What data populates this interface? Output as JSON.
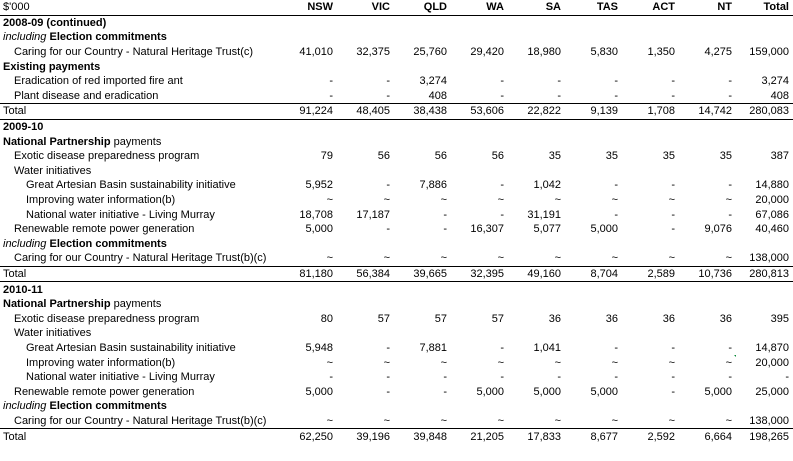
{
  "headers": [
    "$'000",
    "NSW",
    "VIC",
    "QLD",
    "WA",
    "SA",
    "TAS",
    "ACT",
    "NT",
    "Total"
  ],
  "rows": [
    {
      "kind": "year",
      "label": "2008-09 (continued)"
    },
    {
      "kind": "section",
      "prefix": "including",
      "label": "Election commitments"
    },
    {
      "kind": "data",
      "indent": 1,
      "label": "Caring for our Country - Natural Heritage Trust(c)",
      "values": [
        "41,010",
        "32,375",
        "25,760",
        "29,420",
        "18,980",
        "5,830",
        "1,350",
        "4,275",
        "159,000"
      ]
    },
    {
      "kind": "section",
      "prefix": "",
      "label": "Existing payments"
    },
    {
      "kind": "data",
      "indent": 1,
      "label": "Eradication of red imported fire ant",
      "values": [
        "-",
        "-",
        "3,274",
        "-",
        "-",
        "-",
        "-",
        "-",
        "3,274"
      ]
    },
    {
      "kind": "data",
      "indent": 1,
      "label": "Plant disease and eradication",
      "values": [
        "-",
        "-",
        "408",
        "-",
        "-",
        "-",
        "-",
        "-",
        "408"
      ]
    },
    {
      "kind": "total",
      "label": "Total",
      "values": [
        "91,224",
        "48,405",
        "38,438",
        "53,606",
        "22,822",
        "9,139",
        "1,708",
        "14,742",
        "280,083"
      ]
    },
    {
      "kind": "year",
      "label": "2009-10"
    },
    {
      "kind": "section",
      "prefix": "",
      "label": "National Partnership",
      "suffix": " payments"
    },
    {
      "kind": "data",
      "indent": 1,
      "label": "Exotic disease preparedness program",
      "values": [
        "79",
        "56",
        "56",
        "56",
        "35",
        "35",
        "35",
        "35",
        "387"
      ]
    },
    {
      "kind": "data",
      "indent": 1,
      "label": "Water initiatives",
      "values": [
        "",
        "",
        "",
        "",
        "",
        "",
        "",
        "",
        ""
      ]
    },
    {
      "kind": "data",
      "indent": 2,
      "label": "Great Artesian Basin sustainability initiative",
      "values": [
        "5,952",
        "-",
        "7,886",
        "-",
        "1,042",
        "-",
        "-",
        "-",
        "14,880"
      ]
    },
    {
      "kind": "data",
      "indent": 2,
      "label": "Improving water information(b)",
      "values": [
        "~",
        "~",
        "~",
        "~",
        "~",
        "~",
        "~",
        "~",
        "20,000"
      ]
    },
    {
      "kind": "data",
      "indent": 2,
      "label": "National water initiative - Living Murray",
      "values": [
        "18,708",
        "17,187",
        "-",
        "-",
        "31,191",
        "-",
        "-",
        "-",
        "67,086"
      ]
    },
    {
      "kind": "data",
      "indent": 1,
      "label": "Renewable remote power generation",
      "values": [
        "5,000",
        "-",
        "-",
        "16,307",
        "5,077",
        "5,000",
        "-",
        "9,076",
        "40,460"
      ]
    },
    {
      "kind": "section",
      "prefix": "including",
      "label": "Election commitments"
    },
    {
      "kind": "data",
      "indent": 1,
      "label": "Caring for our Country - Natural Heritage Trust(b)(c)",
      "values": [
        "~",
        "~",
        "~",
        "~",
        "~",
        "~",
        "~",
        "~",
        "138,000"
      ]
    },
    {
      "kind": "total",
      "label": "Total",
      "values": [
        "81,180",
        "56,384",
        "39,665",
        "32,395",
        "49,160",
        "8,704",
        "2,589",
        "10,736",
        "280,813"
      ]
    },
    {
      "kind": "year",
      "label": "2010-11"
    },
    {
      "kind": "section",
      "prefix": "",
      "label": "National Partnership",
      "suffix": " payments"
    },
    {
      "kind": "data",
      "indent": 1,
      "label": "Exotic disease preparedness program",
      "values": [
        "80",
        "57",
        "57",
        "57",
        "36",
        "36",
        "36",
        "36",
        "395"
      ]
    },
    {
      "kind": "data",
      "indent": 1,
      "label": "Water initiatives",
      "values": [
        "",
        "",
        "",
        "",
        "",
        "",
        "",
        "",
        ""
      ]
    },
    {
      "kind": "data",
      "indent": 2,
      "label": "Great Artesian Basin sustainability initiative",
      "values": [
        "5,948",
        "-",
        "7,881",
        "-",
        "1,041",
        "-",
        "-",
        "-",
        "14,870"
      ]
    },
    {
      "kind": "data",
      "indent": 2,
      "label": "Improving water information(b)",
      "values": [
        "~",
        "~",
        "~",
        "~",
        "~",
        "~",
        "~",
        "~",
        "20,000"
      ],
      "marker_col": 7
    },
    {
      "kind": "data",
      "indent": 2,
      "label": "National water initiative - Living Murray",
      "values": [
        "-",
        "-",
        "-",
        "-",
        "-",
        "-",
        "-",
        "-",
        "-"
      ]
    },
    {
      "kind": "data",
      "indent": 1,
      "label": "Renewable remote power generation",
      "values": [
        "5,000",
        "-",
        "-",
        "5,000",
        "5,000",
        "5,000",
        "-",
        "5,000",
        "25,000"
      ]
    },
    {
      "kind": "section",
      "prefix": "including",
      "label": "Election commitments"
    },
    {
      "kind": "data",
      "indent": 1,
      "label": "Caring for our Country - Natural Heritage Trust(b)(c)",
      "values": [
        "~",
        "~",
        "~",
        "~",
        "~",
        "~",
        "~",
        "~",
        "138,000"
      ]
    },
    {
      "kind": "total",
      "label": "Total",
      "values": [
        "62,250",
        "39,196",
        "39,848",
        "21,205",
        "17,833",
        "8,677",
        "2,592",
        "6,664",
        "198,265"
      ]
    }
  ]
}
